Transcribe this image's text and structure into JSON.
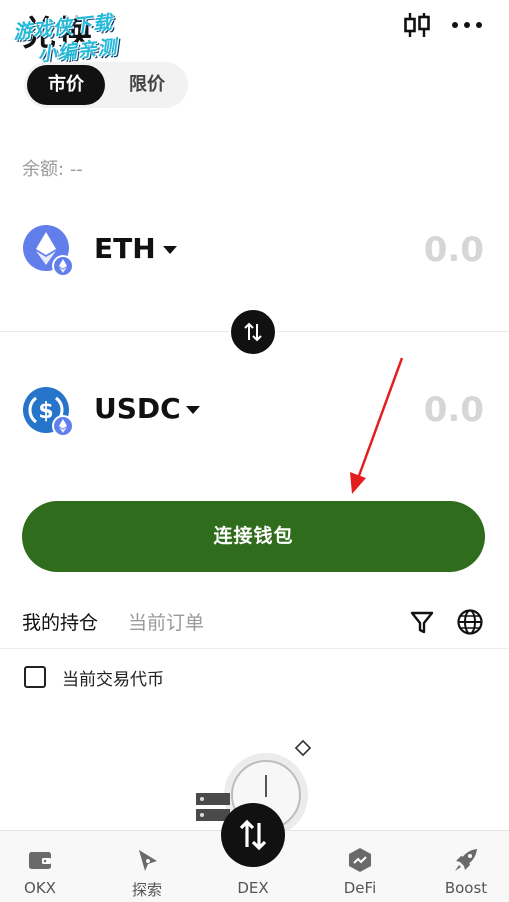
{
  "header": {
    "title": "兑换",
    "watermark_line1": "游戏侠下载",
    "watermark_line2": "小编亲测",
    "icons": {
      "chart": "candlestick-chart-icon",
      "more": "more-dots-icon"
    }
  },
  "order_type": {
    "options": [
      "市价",
      "限价"
    ],
    "selected": "市价"
  },
  "balance": {
    "label": "余额:",
    "value": "--"
  },
  "from_token": {
    "symbol": "ETH",
    "amount": "0.0",
    "icon": "ethereum-icon"
  },
  "to_token": {
    "symbol": "USDC",
    "amount": "0.0",
    "icon": "usdc-icon",
    "network_badge": "ethereum-icon"
  },
  "swap_direction_icon": "swap-arrows-icon",
  "connect_button": {
    "label": "连接钱包",
    "color": "#2f6c1b"
  },
  "positions": {
    "tabs": [
      "我的持仓",
      "当前订单"
    ],
    "active_tab": "我的持仓",
    "current_token_checkbox": {
      "label": "当前交易代币",
      "checked": false
    },
    "icons": {
      "filter": "filter-icon",
      "globe": "globe-icon"
    }
  },
  "bottom_nav": {
    "items": [
      {
        "label": "OKX",
        "icon": "wallet-icon"
      },
      {
        "label": "探索",
        "icon": "compass-icon"
      },
      {
        "label": "DEX",
        "icon": "swap-arrows-icon"
      },
      {
        "label": "DeFi",
        "icon": "trend-icon"
      },
      {
        "label": "Boost",
        "icon": "rocket-icon"
      }
    ],
    "active": "DEX"
  },
  "colors": {
    "accent_green": "#2f6c1b",
    "eth_blue": "#627eea",
    "usdc_blue": "#2775ca",
    "annotation_red": "#e41e1e"
  }
}
